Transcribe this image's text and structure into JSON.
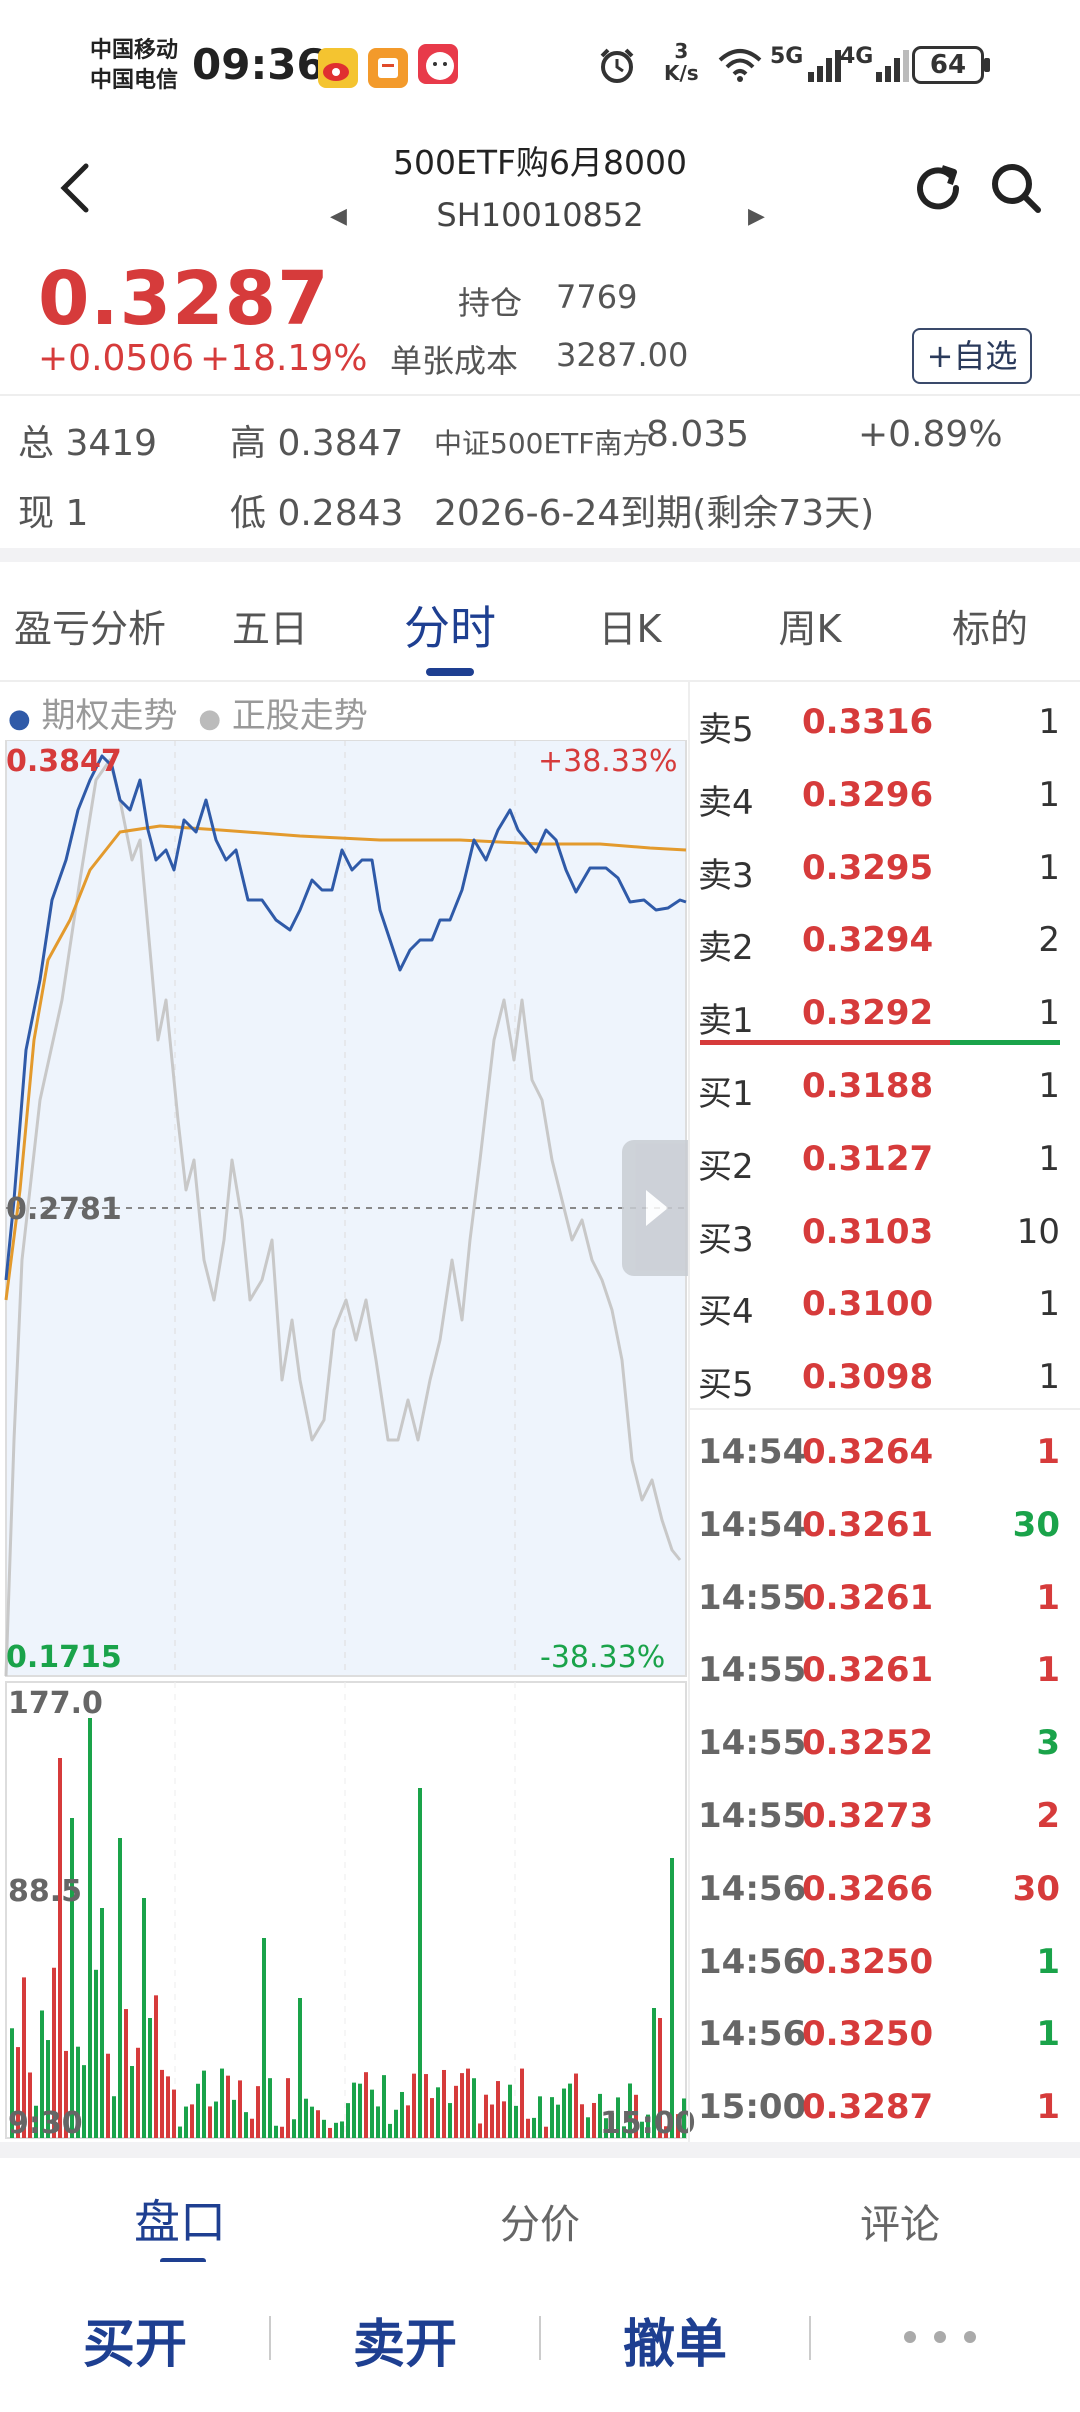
{
  "status_bar": {
    "carrier1": "中国移动",
    "carrier2": "中国电信",
    "time": "09:36",
    "net_speed_value": "3",
    "net_speed_unit": "K/s",
    "signal1": "5G",
    "signal2": "4G",
    "battery": "64"
  },
  "header": {
    "title": "500ETF购6月8000",
    "code": "SH10010852"
  },
  "quote": {
    "price": "0.3287",
    "change": "+0.0506",
    "change_pct": "+18.19%",
    "hold_label": "持仓",
    "hold_value": "7769",
    "cost_label": "单张成本",
    "cost_value": "3287.00",
    "watch_button": "+自选"
  },
  "stats": {
    "total": "总 3419",
    "high": "高 0.3847",
    "underlying_name": "中证500ETF南方",
    "underlying_price": "8.035",
    "underlying_pct": "+0.89%",
    "current": "现 1",
    "low": "低 0.2843",
    "expiry": "2026-6-24到期(剩余73天)"
  },
  "tabs": [
    "盈亏分析",
    "五日",
    "分时",
    "日K",
    "周K",
    "标的"
  ],
  "active_tab": 2,
  "chart": {
    "legend_option": "期权走势",
    "legend_stock": "正股走势",
    "max_label": "0.3847",
    "max_pct": "+38.33%",
    "mid_label": "0.2781",
    "min_label": "0.1715",
    "min_pct": "-38.33%",
    "vol_max": "177.0",
    "vol_mid": "88.5",
    "time_start": "9:30",
    "time_end": "15:00",
    "colors": {
      "option_line": "#2f5aa8",
      "avg_line": "#e39a2d",
      "stock_line": "#c8c8c8",
      "up": "#d63b3b",
      "down": "#1aa34a"
    }
  },
  "orderbook": {
    "asks": [
      {
        "label": "卖5",
        "price": "0.3316",
        "vol": "1"
      },
      {
        "label": "卖4",
        "price": "0.3296",
        "vol": "1"
      },
      {
        "label": "卖3",
        "price": "0.3295",
        "vol": "1"
      },
      {
        "label": "卖2",
        "price": "0.3294",
        "vol": "2"
      },
      {
        "label": "卖1",
        "price": "0.3292",
        "vol": "1"
      }
    ],
    "bids": [
      {
        "label": "买1",
        "price": "0.3188",
        "vol": "1"
      },
      {
        "label": "买2",
        "price": "0.3127",
        "vol": "1"
      },
      {
        "label": "买3",
        "price": "0.3103",
        "vol": "10"
      },
      {
        "label": "买4",
        "price": "0.3100",
        "vol": "1"
      },
      {
        "label": "买5",
        "price": "0.3098",
        "vol": "1"
      }
    ]
  },
  "ticks": [
    {
      "time": "14:54",
      "price": "0.3264",
      "vol": "1",
      "dir": "up"
    },
    {
      "time": "14:54",
      "price": "0.3261",
      "vol": "30",
      "dir": "down"
    },
    {
      "time": "14:55",
      "price": "0.3261",
      "vol": "1",
      "dir": "up"
    },
    {
      "time": "14:55",
      "price": "0.3261",
      "vol": "1",
      "dir": "up"
    },
    {
      "time": "14:55",
      "price": "0.3252",
      "vol": "3",
      "dir": "down"
    },
    {
      "time": "14:55",
      "price": "0.3273",
      "vol": "2",
      "dir": "up"
    },
    {
      "time": "14:56",
      "price": "0.3266",
      "vol": "30",
      "dir": "up"
    },
    {
      "time": "14:56",
      "price": "0.3250",
      "vol": "1",
      "dir": "down"
    },
    {
      "time": "14:56",
      "price": "0.3250",
      "vol": "1",
      "dir": "down"
    },
    {
      "time": "15:00",
      "price": "0.3287",
      "vol": "1",
      "dir": "up"
    }
  ],
  "bottom_tabs": [
    "盘口",
    "分价",
    "评论"
  ],
  "actions": [
    "买开",
    "卖开",
    "撤单"
  ],
  "icons": {
    "back": "chevron-left-icon",
    "refresh": "refresh-icon",
    "search": "search-icon",
    "more": "more-dots-icon"
  }
}
